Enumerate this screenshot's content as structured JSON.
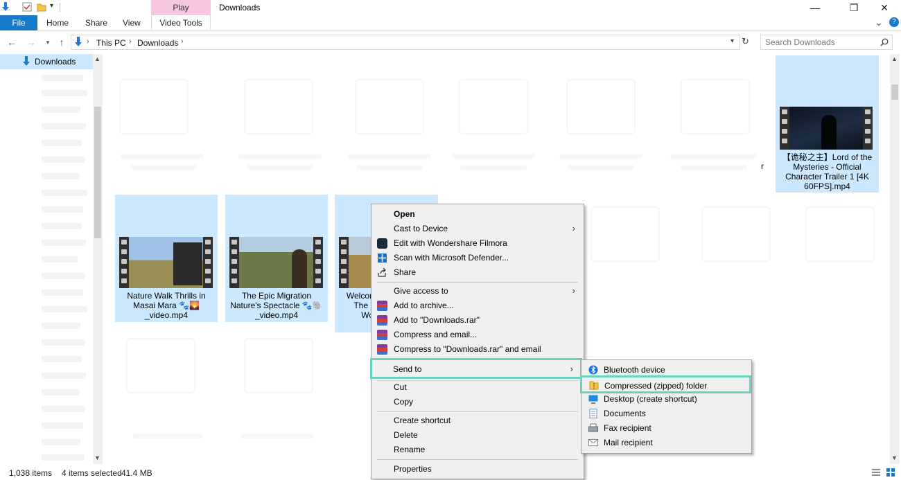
{
  "window": {
    "title": "Downloads",
    "contextual_tab_group": "Play",
    "controls": {
      "minimize": "—",
      "maximize": "❐",
      "close": "✕"
    }
  },
  "ribbon": {
    "tabs": [
      {
        "label": "File"
      },
      {
        "label": "Home"
      },
      {
        "label": "Share"
      },
      {
        "label": "View"
      },
      {
        "label": "Video Tools"
      }
    ],
    "expand_glyph": "⌄",
    "help_glyph": "?"
  },
  "address": {
    "breadcrumb": [
      "This PC",
      "Downloads"
    ],
    "separator": "›",
    "search_placeholder": "Search Downloads"
  },
  "nav_pane": {
    "selected_item": "Downloads"
  },
  "files": [
    {
      "name": "【诡秘之主】Lord of the Mysteries - Official Character Trailer 1 [4K 60FPS].mp4",
      "lines": [
        "【诡秘之主】Lord of the",
        "Mysteries - Official",
        "Character Trailer 1 [4K",
        "60FPS].mp4"
      ]
    },
    {
      "name": "Nature Walk Thrills in Masai Mara _video.mp4",
      "lines": [
        "Nature Walk Thrills in",
        "Masai Mara 🐾🌄",
        "_video.mp4"
      ]
    },
    {
      "name": "The Epic Migration Nature's Spectacle _video.mp4",
      "lines": [
        "The Epic Migration",
        "Nature's Spectacle 🐾🐘",
        "_video.mp4"
      ]
    },
    {
      "name": "Welcome to The U... Wor...",
      "lines": [
        "Welcom",
        "The U",
        "Wor",
        "_"
      ]
    }
  ],
  "stray_text": "r",
  "context_menu": {
    "items": [
      {
        "label": "Open",
        "bold": true
      },
      {
        "label": "Cast to Device",
        "submenu": true
      },
      {
        "label": "Edit with Wondershare Filmora",
        "icon": "filmora-icon"
      },
      {
        "label": "Scan with Microsoft Defender...",
        "icon": "defender-icon"
      },
      {
        "label": "Share",
        "icon": "share-icon"
      },
      {
        "label": "Give access to",
        "submenu": true
      },
      {
        "label": "Add to archive...",
        "icon": "winrar-icon"
      },
      {
        "label": "Add to \"Downloads.rar\"",
        "icon": "winrar-icon"
      },
      {
        "label": "Compress and email...",
        "icon": "winrar-icon"
      },
      {
        "label": "Compress to \"Downloads.rar\" and email",
        "icon": "winrar-icon"
      },
      {
        "label": "Send to",
        "submenu": true,
        "highlighted": true
      },
      {
        "label": "Cut"
      },
      {
        "label": "Copy"
      },
      {
        "label": "Create shortcut"
      },
      {
        "label": "Delete"
      },
      {
        "label": "Rename"
      },
      {
        "label": "Properties"
      }
    ],
    "arrow_glyph": "›"
  },
  "send_to_menu": {
    "items": [
      {
        "label": "Bluetooth device",
        "icon": "bluetooth-icon"
      },
      {
        "label": "Compressed (zipped) folder",
        "icon": "zip-folder-icon",
        "highlighted": true
      },
      {
        "label": "Desktop (create shortcut)",
        "icon": "desktop-icon"
      },
      {
        "label": "Documents",
        "icon": "documents-icon"
      },
      {
        "label": "Fax recipient",
        "icon": "fax-icon"
      },
      {
        "label": "Mail recipient",
        "icon": "mail-icon"
      }
    ]
  },
  "status": {
    "item_count": "1,038 items",
    "selection": "4 items selected",
    "size": "41.4 MB"
  },
  "colors": {
    "accent": "#1979ca",
    "selection": "#cce8ff",
    "highlight_outline": "#67d4c1",
    "play_tab": "#f7c6e0"
  }
}
